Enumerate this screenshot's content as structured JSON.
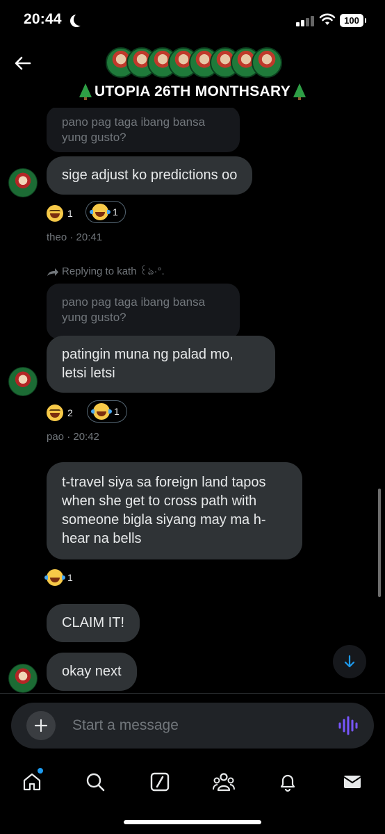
{
  "status_bar": {
    "time": "20:44",
    "battery": "100"
  },
  "header": {
    "title": "UTOPIA 26TH MONTHSARY",
    "member_avatar_count": 8
  },
  "messages": [
    {
      "quoted": "pano pag taga ibang bansa yung gusto?",
      "text": "sige adjust ko predictions oo",
      "reactions": [
        {
          "emoji": "laughing-face",
          "count": "1"
        },
        {
          "emoji": "tears-of-joy",
          "count": "1",
          "selected": true
        }
      ],
      "meta": "theo · 20:41"
    },
    {
      "reply_to": "Replying to kath ꒰ঌ·°.",
      "quoted": "pano pag taga ibang bansa yung gusto?",
      "text": "patingin muna ng palad mo, letsi letsi",
      "reactions": [
        {
          "emoji": "laughing-face",
          "count": "2"
        },
        {
          "emoji": "tears-of-joy",
          "count": "1",
          "selected": true
        }
      ],
      "meta": "pao · 20:42"
    },
    {
      "text": "t-travel siya sa foreign land tapos when she get to cross path with someone bigla siyang may ma h-hear na bells",
      "reactions": [
        {
          "emoji": "tears-of-joy",
          "count": "1"
        }
      ]
    },
    {
      "text": "CLAIM IT!"
    },
    {
      "text": "okay next"
    }
  ],
  "composer": {
    "placeholder": "Start a message"
  },
  "tabbar": {
    "items": [
      "home",
      "search",
      "grok",
      "communities",
      "notifications",
      "messages"
    ]
  },
  "colors": {
    "background": "#000000",
    "bubble": "#2f3336",
    "quote": "#16181c",
    "accent": "#1d9bf0",
    "voice": "#7856ff"
  }
}
